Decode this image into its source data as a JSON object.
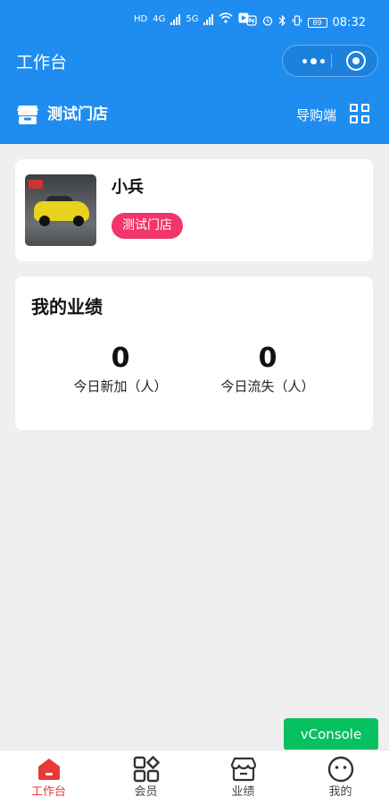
{
  "status_bar": {
    "time": "08:32",
    "battery": "89",
    "network_left": "HD",
    "network_type": "4G",
    "network_type_2": "5G"
  },
  "nav": {
    "title": "工作台"
  },
  "store_bar": {
    "store_name": "测试门店",
    "guide_link": "导购端"
  },
  "profile": {
    "name": "小兵",
    "store_tag": "测试门店"
  },
  "performance": {
    "title": "我的业绩",
    "stats": [
      {
        "value": "0",
        "label": "今日新加（人）"
      },
      {
        "value": "0",
        "label": "今日流失（人）"
      }
    ]
  },
  "vconsole": {
    "label": "vConsole"
  },
  "tabbar": {
    "tabs": [
      {
        "label": "工作台",
        "icon": "home-icon",
        "active": true
      },
      {
        "label": "会员",
        "icon": "apps-icon",
        "active": false
      },
      {
        "label": "业绩",
        "icon": "store-icon",
        "active": false
      },
      {
        "label": "我的",
        "icon": "smiley-icon",
        "active": false
      }
    ]
  },
  "colors": {
    "primary": "#1f8df0",
    "tag": "#f2356b",
    "active_tab": "#e63a3a",
    "vconsole": "#07c160"
  }
}
